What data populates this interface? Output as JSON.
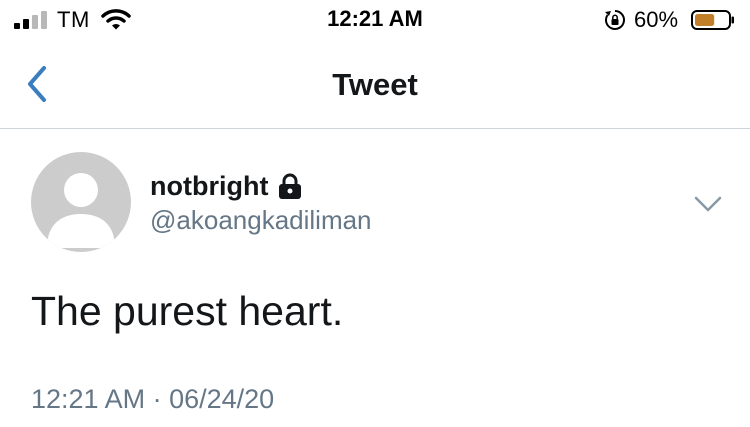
{
  "status_bar": {
    "carrier": "TM",
    "time": "12:21 AM",
    "battery_percent": "60%",
    "battery_level": 0.6,
    "battery_color": "#c17f2a",
    "signal_bars_filled": 2,
    "signal_bars_total": 4,
    "icons": [
      "signal-icon",
      "wifi-icon",
      "rotation-lock-icon",
      "battery-icon"
    ]
  },
  "nav": {
    "title": "Tweet",
    "back_icon": "back-chevron-icon",
    "accent_color": "#3b7ec0"
  },
  "tweet": {
    "display_name": "notbright",
    "protected_icon": "lock-icon",
    "handle": "@akoangkadiliman",
    "text": "The purest heart.",
    "timestamp": "12:21 AM · 06/24/20",
    "menu_icon": "chevron-down-icon",
    "avatar_icon": "default-avatar-icon"
  }
}
